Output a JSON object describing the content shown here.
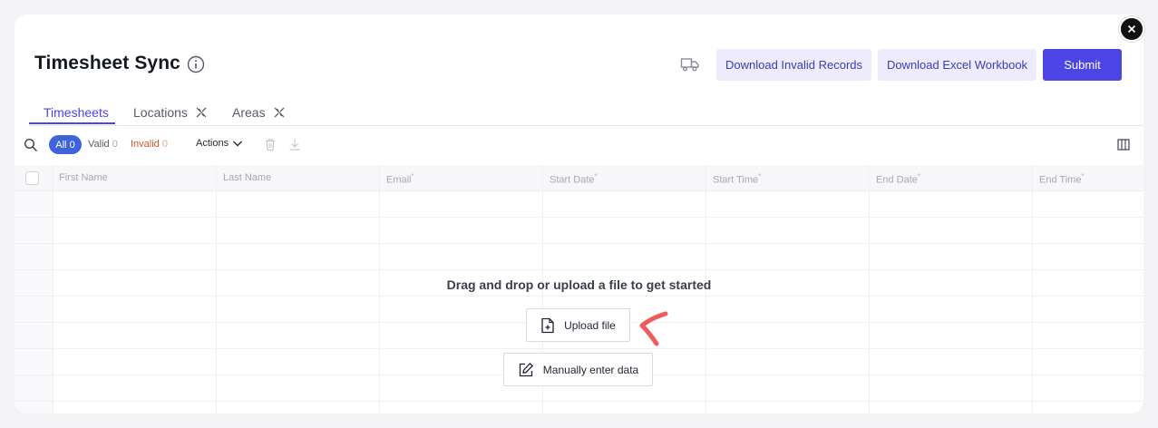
{
  "header": {
    "title": "Timesheet Sync",
    "download_invalid_label": "Download Invalid Records",
    "download_excel_label": "Download Excel Workbook",
    "submit_label": "Submit"
  },
  "tabs": [
    {
      "label": "Timesheets",
      "active": true
    },
    {
      "label": "Locations",
      "active": false
    },
    {
      "label": "Areas",
      "active": false
    }
  ],
  "filters": {
    "all_label": "All",
    "all_count": "0",
    "valid_label": "Valid",
    "valid_count": "0",
    "invalid_label": "Invalid",
    "invalid_count": "0",
    "actions_label": "Actions"
  },
  "columns": [
    {
      "label": "First Name",
      "required": false
    },
    {
      "label": "Last Name",
      "required": false
    },
    {
      "label": "Email",
      "required": true
    },
    {
      "label": "Start Date",
      "required": true
    },
    {
      "label": "Start Time",
      "required": true
    },
    {
      "label": "End Date",
      "required": true
    },
    {
      "label": "End Time",
      "required": true
    }
  ],
  "required_mark": "*",
  "empty_state": {
    "message": "Drag and drop or upload a file to get started",
    "upload_label": "Upload file",
    "manual_label": "Manually enter data"
  },
  "colors": {
    "accent": "#4b45e6",
    "invalid": "#d9542b",
    "arrow": "#f05a5a"
  },
  "icons": [
    "close-icon",
    "info-icon",
    "truck-icon",
    "unlink-icon",
    "search-icon",
    "chevron-down-icon",
    "trash-icon",
    "download-icon",
    "columns-icon",
    "file-plus-icon",
    "edit-icon"
  ]
}
